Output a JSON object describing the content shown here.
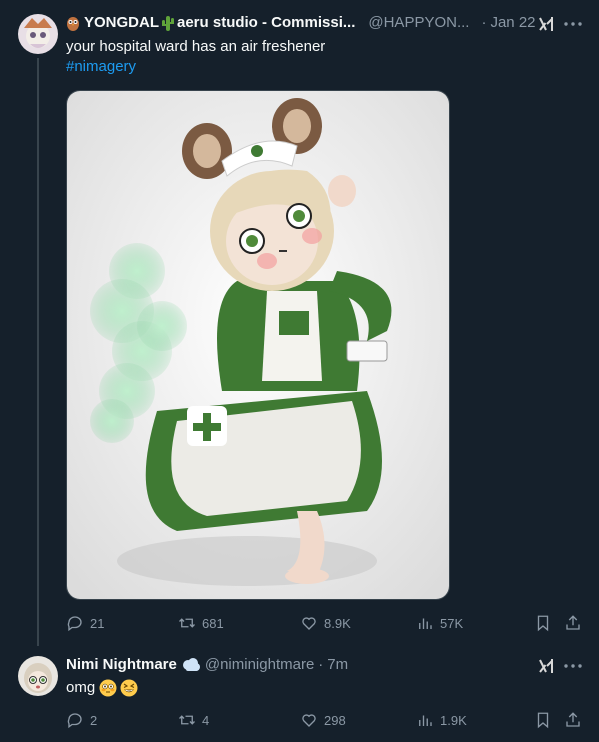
{
  "tweet1": {
    "name_prefix": "YONGDAL",
    "name_suffix": "aeru studio - Commissi...",
    "handle": "@HAPPYON...",
    "dot": "·",
    "date": "Jan 22",
    "text": "your hospital ward has an air freshener",
    "hashtag": "#nimagery",
    "actions": {
      "replies": "21",
      "retweets": "681",
      "likes": "8.9K",
      "views": "57K"
    }
  },
  "tweet2": {
    "name": "Nimi Nightmare",
    "handle": "@niminightmare",
    "dot": "·",
    "date": "7m",
    "text": "omg",
    "actions": {
      "replies": "2",
      "retweets": "4",
      "likes": "298",
      "views": "1.9K"
    }
  },
  "colors": {
    "background": "#15202b",
    "muted": "#8b98a5",
    "link": "#1d9bf0",
    "border": "#38444d"
  },
  "icons": [
    "owl-emoji",
    "cactus-emoji",
    "grok-icon",
    "more-icon",
    "reply-icon",
    "retweet-icon",
    "like-icon",
    "views-icon",
    "bookmark-icon",
    "share-icon",
    "verified-cloud-icon",
    "flushed-emoji",
    "laughing-emoji"
  ]
}
